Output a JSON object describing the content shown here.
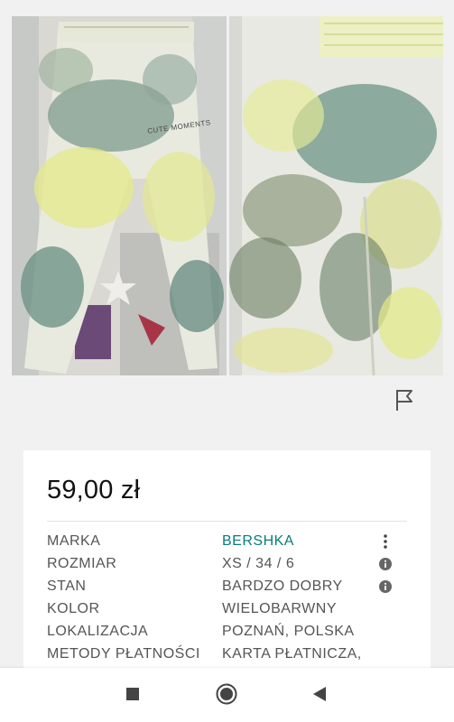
{
  "listing": {
    "price": "59,00 zł",
    "details": [
      {
        "label": "MARKA",
        "value": "BERSHKA",
        "link": true,
        "icon": "more-vertical-icon"
      },
      {
        "label": "ROZMIAR",
        "value": "XS / 34 / 6",
        "link": false,
        "icon": "info-icon"
      },
      {
        "label": "STAN",
        "value": "BARDZO DOBRY",
        "link": false,
        "icon": "info-icon"
      },
      {
        "label": "KOLOR",
        "value": "WIELOBARWNY",
        "link": false,
        "icon": ""
      },
      {
        "label": "LOKALIZACJA",
        "value": "POZNAŃ, POLSKA",
        "link": false,
        "icon": ""
      },
      {
        "label": "METODY PŁATNOŚCI",
        "value": "KARTA PŁATNICZA,",
        "link": false,
        "icon": ""
      }
    ]
  },
  "photo_label": "CUTE MOMENTS",
  "colors": {
    "link": "#097a7c",
    "background": "#f1f1f1",
    "card": "#ffffff"
  },
  "icons": {
    "report": "flag-icon",
    "nav": [
      "square-recents-icon",
      "circle-home-icon",
      "triangle-back-icon"
    ]
  }
}
